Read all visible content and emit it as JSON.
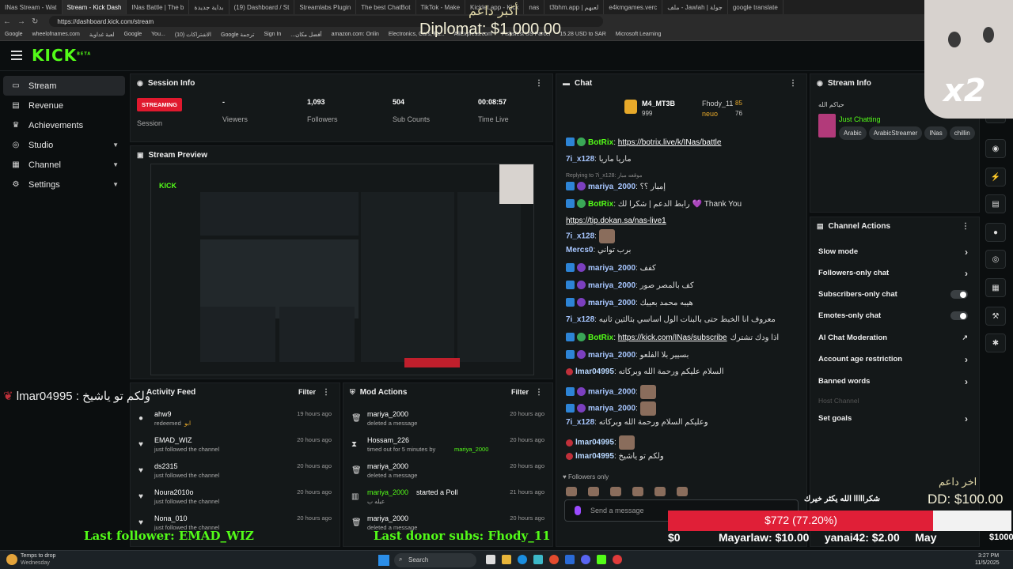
{
  "browser": {
    "tabs": [
      "INas Stream - Wat",
      "Stream - Kick Dash",
      "INas Battle | The b",
      "بداية جديدة",
      "(19) Dashboard / St",
      "Streamlabs Plugin",
      "The best ChatBot",
      "TikTok - Make",
      "Kicklet.app - Kick",
      "nas",
      "t3bhm.app | لعبهم",
      "e4kmgames.verc",
      "ملف - Jawlah | جولة",
      "google translate"
    ],
    "url": "https://dashboard.kick.com/stream",
    "bookmarks": [
      "Google",
      "wheelofnames.com",
      "لعبة غداوية",
      "Google",
      "You...",
      "(10) الاشتراكات",
      "Google ترجمة",
      "Sign In",
      "...أفضل مكان",
      "amazon.com: Onlin",
      "Electronics, Cars, Fa...",
      "AliExpress.com",
      "Fishsfest US Parcel",
      "15.28 USD to SAR",
      "Microsoft Learning"
    ]
  },
  "header": {
    "logo": "KICK",
    "logo_sup": "BETA"
  },
  "sidebar": {
    "items": [
      {
        "label": "Stream",
        "icon": "▭"
      },
      {
        "label": "Revenue",
        "icon": "▤"
      },
      {
        "label": "Achievements",
        "icon": "🏆"
      },
      {
        "label": "Studio",
        "icon": "⚙"
      },
      {
        "label": "Channel",
        "icon": "▦"
      },
      {
        "label": "Settings",
        "icon": "⚙"
      }
    ]
  },
  "session": {
    "title": "Session Info",
    "badge": "STREAMING",
    "session_label": "Session",
    "viewers_value": "-",
    "viewers_label": "Viewers",
    "followers_value": "1,093",
    "followers_label": "Followers",
    "subs_value": "504",
    "subs_label": "Sub Counts",
    "time_value": "00:08:57",
    "time_label": "Time Live"
  },
  "preview": {
    "title": "Stream Preview"
  },
  "activity": {
    "title": "Activity Feed",
    "filter": "Filter",
    "rows": [
      {
        "name": "ahw9",
        "sub": "redeemed",
        "extra": "ابو",
        "time": "19 hours ago"
      },
      {
        "name": "EMAD_WIZ",
        "sub": "just followed the channel",
        "time": "20 hours ago"
      },
      {
        "name": "ds2315",
        "sub": "just followed the channel",
        "time": "20 hours ago"
      },
      {
        "name": "Noura2010o",
        "sub": "just followed the channel",
        "time": "20 hours ago"
      },
      {
        "name": "Nona_010",
        "sub": "just followed the channel",
        "time": "20 hours ago"
      }
    ]
  },
  "mod": {
    "title": "Mod Actions",
    "filter": "Filter",
    "rows": [
      {
        "name": "mariya_2000",
        "sub": "deleted a message",
        "time": "20 hours ago"
      },
      {
        "name": "Hossam_226",
        "sub": "timed out for 5 minutes by",
        "by": "mariya_2000",
        "time": "20 hours ago"
      },
      {
        "name": "mariya_2000",
        "sub": "deleted a message",
        "time": "20 hours ago"
      },
      {
        "name": "mariya_2000",
        "sub": "started a Poll",
        "extra": "عيله ب",
        "time": "21 hours ago"
      },
      {
        "name": "mariya_2000",
        "sub": "deleted a message",
        "time": "20 hours ago"
      }
    ]
  },
  "chat": {
    "title": "Chat",
    "top": {
      "user1": "M4_MT3B",
      "user1_val": "999",
      "user2": "Fhody_11",
      "user2_val": "85",
      "user3": "neuo",
      "user3_val": "76"
    },
    "lines": [
      {
        "user": "BotRix",
        "text": "",
        "link": "https://botrix.live/k/INas/battle"
      },
      {
        "user": "7i_x128",
        "text": "ماريا ماريا"
      },
      {
        "reply": "Replying to 7i_x128: موقعه مبار"
      },
      {
        "user": "mariya_2000",
        "text": "إمبار ؟؟"
      },
      {
        "user": "BotRix",
        "text": "رابط الدعم | شكرا لك 💜 Thank You"
      },
      {
        "link_only": "https://tip.dokan.sa/nas-live1"
      },
      {
        "user": "7i_x128",
        "text": ""
      },
      {
        "user": "Mercs0",
        "text": "برب تواني"
      },
      {
        "user": "mariya_2000",
        "text": "كفف"
      },
      {
        "user": "mariya_2000",
        "text": "كف بالمصر صور"
      },
      {
        "user": "mariya_2000",
        "text": "هيبه محمد بعييك"
      },
      {
        "user": "7i_x128",
        "text": "معروف انا الخبط حتى بالبنات الول اساسي بثالثين ثانيه"
      },
      {
        "user": "BotRix",
        "text": "اذا ودك تشترك",
        "link": "https://kick.com/INas/subscribe"
      },
      {
        "user": "mariya_2000",
        "text": "بسيير بلا الفلعو"
      },
      {
        "user": "lmar04995",
        "text": "السلام عليكم ورحمة الله وبركاته"
      },
      {
        "user": "mariya_2000",
        "text": ""
      },
      {
        "user": "mariya_2000",
        "text": ""
      },
      {
        "user": "7i_x128",
        "text": "وعليكم السلام ورحمة الله وبركاته"
      },
      {
        "user": "lmar04995",
        "text": ""
      },
      {
        "user": "lmar04995",
        "text": "ولكم تو ياشيخ"
      }
    ],
    "followers_only": "Followers only",
    "placeholder": "Send a message"
  },
  "stream_info": {
    "title": "Stream Info",
    "stream_title": "حياكم الله",
    "category": "Just Chatting",
    "tags": [
      "Arabic",
      "ArabicStreamer",
      "INas",
      "chillin"
    ]
  },
  "channel_actions": {
    "title": "Channel Actions",
    "rows": [
      {
        "label": "Slow mode",
        "type": "arrow"
      },
      {
        "label": "Followers-only chat",
        "type": "arrow"
      },
      {
        "label": "Subscribers-only chat",
        "type": "toggle"
      },
      {
        "label": "Emotes-only chat",
        "type": "toggle"
      },
      {
        "label": "AI Chat Moderation",
        "type": "ext"
      },
      {
        "label": "Account age restriction",
        "type": "arrow"
      },
      {
        "label": "Banned words",
        "type": "arrow"
      },
      {
        "label": "Host Channel",
        "type": "disabled"
      },
      {
        "label": "Set goals",
        "type": "arrow"
      }
    ]
  },
  "overlay": {
    "top_ar": "أكبر داعم",
    "top_donor": "Diplomat: $1,000.00",
    "x2": "x2",
    "last_follower": "Last follower: EMAD_WIZ",
    "last_donor": "Last donor subs: Fhody_11",
    "chat_overlay": "lmar04995 : ولكم تو ياشيخ",
    "thanks_ar": "شكرااااا الله يكثر خيرك",
    "last_ar": "اخر داعم",
    "last_dd": "DD: $100.00",
    "goal_bar": "$772 (77.20%)",
    "goal_fraction": 0.772,
    "goal_start": "$0",
    "goal_end": "$1000",
    "ticker": "Mayarlaw: $10.00     yanai42: $2.00     May"
  },
  "taskbar": {
    "weather": "Temps to drop",
    "weather_sub": "Wednesday",
    "search": "Search",
    "time": "3:27 PM",
    "date": "11/5/2025"
  }
}
